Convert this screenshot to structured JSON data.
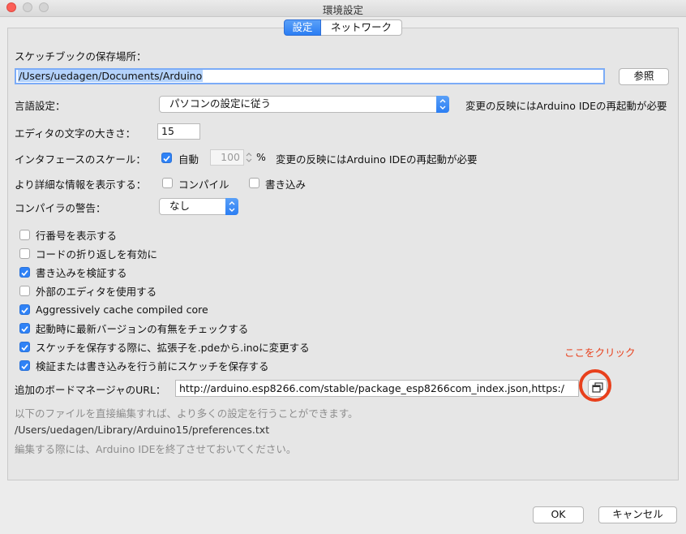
{
  "window": {
    "title": "環境設定"
  },
  "tabs": [
    {
      "label": "設定",
      "active": true
    },
    {
      "label": "ネットワーク",
      "active": false
    }
  ],
  "sketchbook": {
    "label": "スケッチブックの保存場所：",
    "path": "/Users/uedagen/Documents/Arduino",
    "browse_label": "参照"
  },
  "language": {
    "label": "言語設定：",
    "value": "パソコンの設定に従う",
    "note": "変更の反映にはArduino IDEの再起動が必要"
  },
  "font_size": {
    "label": "エディタの文字の大きさ：",
    "value": "15"
  },
  "scale": {
    "label": "インタフェースのスケール：",
    "auto_label": "自動",
    "auto_checked": true,
    "value": "100",
    "unit": "%",
    "note": "変更の反映にはArduino IDEの再起動が必要"
  },
  "verbose": {
    "label": "より詳細な情報を表示する：",
    "compile_label": "コンパイル",
    "compile_checked": false,
    "upload_label": "書き込み",
    "upload_checked": false
  },
  "warnings": {
    "label": "コンパイラの警告：",
    "value": "なし"
  },
  "options": [
    {
      "label": "行番号を表示する",
      "checked": false
    },
    {
      "label": "コードの折り返しを有効に",
      "checked": false
    },
    {
      "label": "書き込みを検証する",
      "checked": true
    },
    {
      "label": "外部のエディタを使用する",
      "checked": false
    },
    {
      "label": "Aggressively cache compiled core",
      "checked": true
    },
    {
      "label": "起動時に最新バージョンの有無をチェックする",
      "checked": true
    },
    {
      "label": "スケッチを保存する際に、拡張子を.pdeから.inoに変更する",
      "checked": true
    },
    {
      "label": "検証または書き込みを行う前にスケッチを保存する",
      "checked": true
    }
  ],
  "annotation": {
    "text": "ここをクリック",
    "color": "#e8401c"
  },
  "board_urls": {
    "label": "追加のボードマネージャのURL：",
    "value": "http://arduino.esp8266.com/stable/package_esp8266com_index.json,https:/"
  },
  "prefs_info": {
    "line1": "以下のファイルを直接編集すれば、より多くの設定を行うことができます。",
    "path": "/Users/uedagen/Library/Arduino15/preferences.txt",
    "line2": "編集する際には、Arduino IDEを終了させておいてください。"
  },
  "buttons": {
    "ok": "OK",
    "cancel": "キャンセル"
  },
  "colors": {
    "accent": "#2f82f6",
    "annotation": "#e8401c",
    "close": "#fc5f57"
  },
  "icons": {
    "window_button": "window-stack-icon",
    "checkmark": "checkmark-icon",
    "stepper": "stepper-icon"
  }
}
